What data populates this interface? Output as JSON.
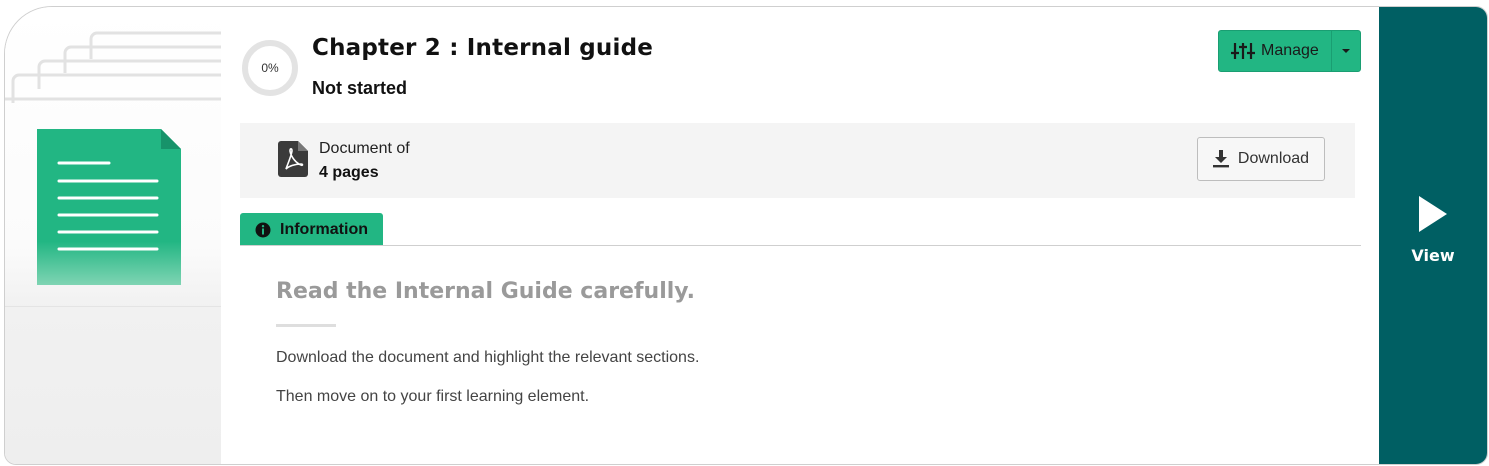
{
  "module": {
    "progress_percent": 0,
    "progress_label": "0%",
    "title": "Chapter 2 : Internal guide",
    "status": "Not started"
  },
  "actions": {
    "manage_label": "Manage",
    "view_label": "View"
  },
  "document": {
    "type_label": "Document of",
    "pages_label": "4 pages",
    "download_label": "Download"
  },
  "tabs": [
    {
      "label": "Information",
      "active": true
    }
  ],
  "information": {
    "heading": "Read the Internal Guide carefully.",
    "lines": [
      "Download the document and highlight the relevant sections.",
      "Then move on to your first learning element."
    ]
  },
  "colors": {
    "accent_green": "#22b683",
    "view_panel": "#005f63",
    "heading_gray": "#9a9a9a"
  },
  "icons": {
    "manage": "sliders-icon",
    "caret": "caret-down-icon",
    "document": "pdf-icon",
    "download": "download-icon",
    "info": "info-circle-icon",
    "view": "play-icon"
  }
}
